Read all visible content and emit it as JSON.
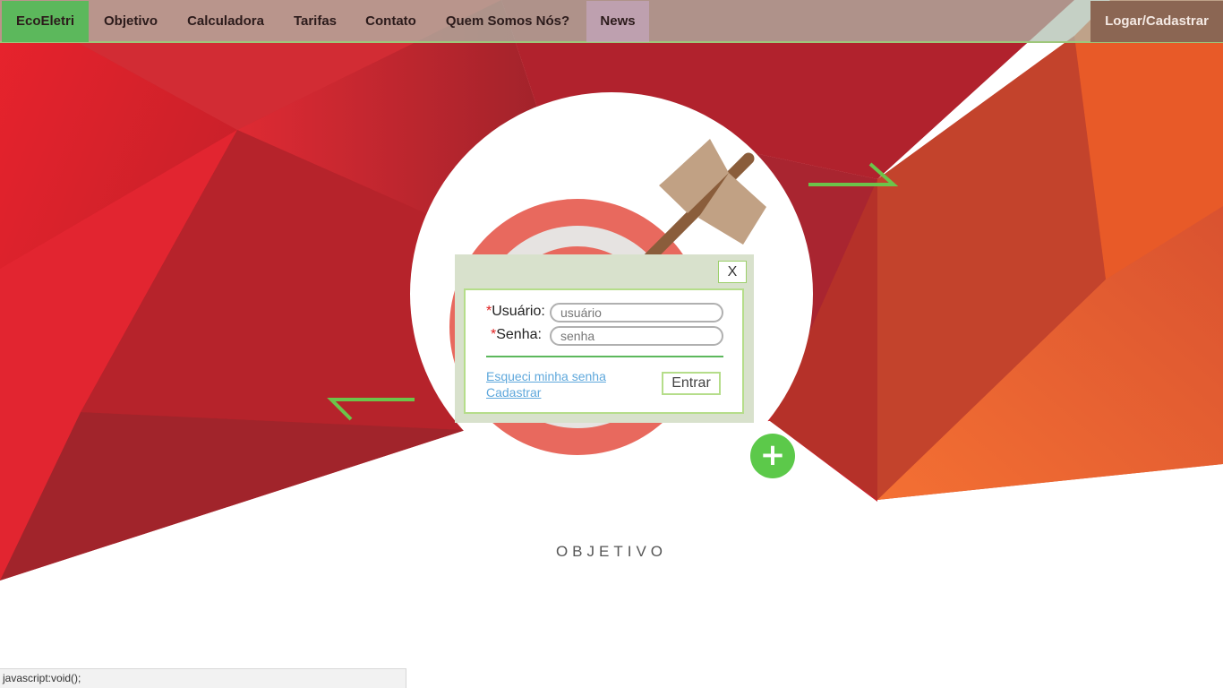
{
  "nav": {
    "brand": "EcoEletri",
    "items": [
      "Objetivo",
      "Calculadora",
      "Tarifas",
      "Contato",
      "Quem Somos Nós?",
      "News"
    ],
    "login": "Logar/Cadastrar"
  },
  "login_modal": {
    "close": "X",
    "required_mark": "*",
    "user_label": "Usuário:",
    "user_placeholder": "usuário",
    "password_label": "Senha:",
    "password_placeholder": "senha",
    "forgot_link": "Esqueci minha senha",
    "register_link": "Cadastrar",
    "submit": "Entrar"
  },
  "plus_button": "+",
  "section_title": "OBJETIVO",
  "status_bar": "javascript:void();",
  "colors": {
    "brand_green": "#5cb85c",
    "accent_green": "#5cc94a",
    "hero_red": "#c9252b",
    "hero_orange": "#f0642a"
  },
  "icons": [
    "target-icon",
    "arrow-icon",
    "plus-icon",
    "close-icon"
  ]
}
